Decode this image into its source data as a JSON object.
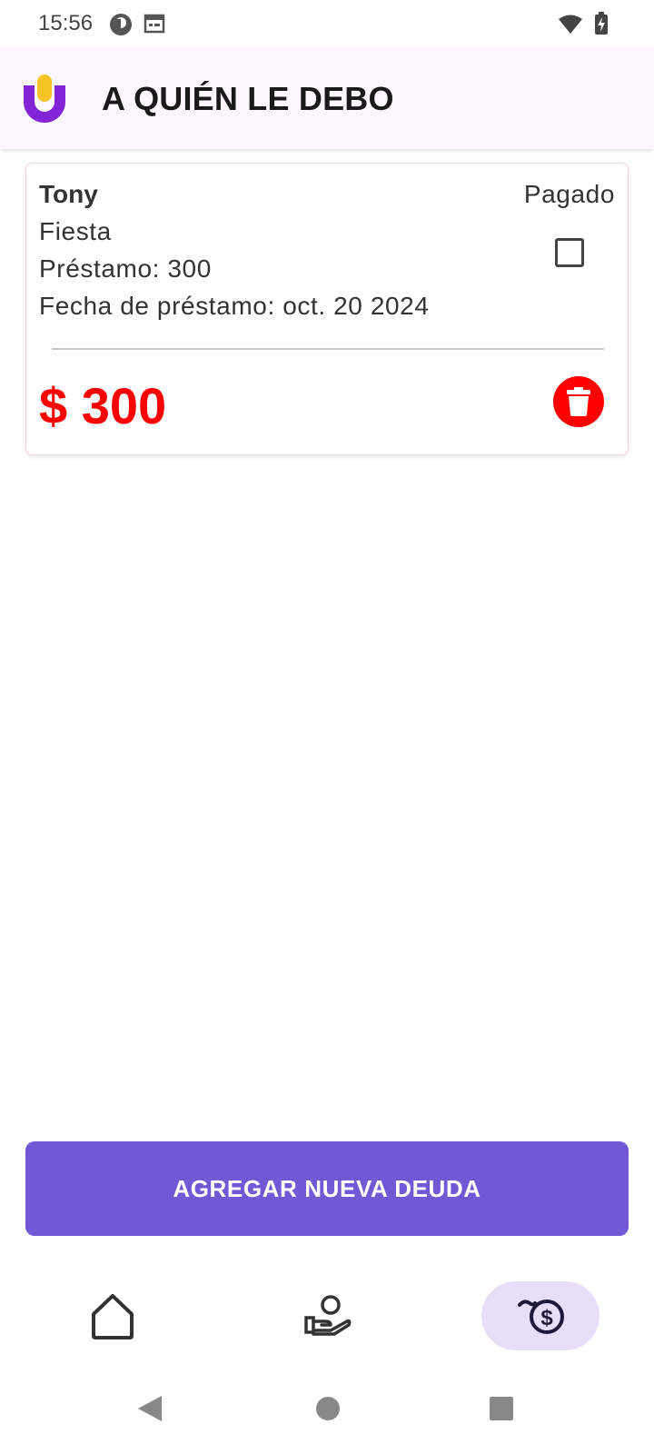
{
  "status_bar": {
    "time": "15:56"
  },
  "app_bar": {
    "title": "A QUIÉN LE DEBO",
    "logo": "app-logo-icon"
  },
  "debt": {
    "name": "Tony",
    "description": "Fiesta",
    "loan": "Préstamo: 300",
    "date": "Fecha de préstamo: oct. 20 2024",
    "paid_label": "Pagado",
    "paid": false,
    "amount": "$ 300",
    "amount_color": "#ff0000"
  },
  "actions": {
    "add_debt_label": "AGREGAR NUEVA DEUDA",
    "accent": "#7159d6"
  },
  "bottom_nav": {
    "items": [
      {
        "icon": "home-icon",
        "active": false
      },
      {
        "icon": "hand-person-icon",
        "active": false
      },
      {
        "icon": "money-debt-icon",
        "active": true
      }
    ]
  },
  "system_nav": [
    "back-icon",
    "home-circle-icon",
    "recents-icon"
  ]
}
